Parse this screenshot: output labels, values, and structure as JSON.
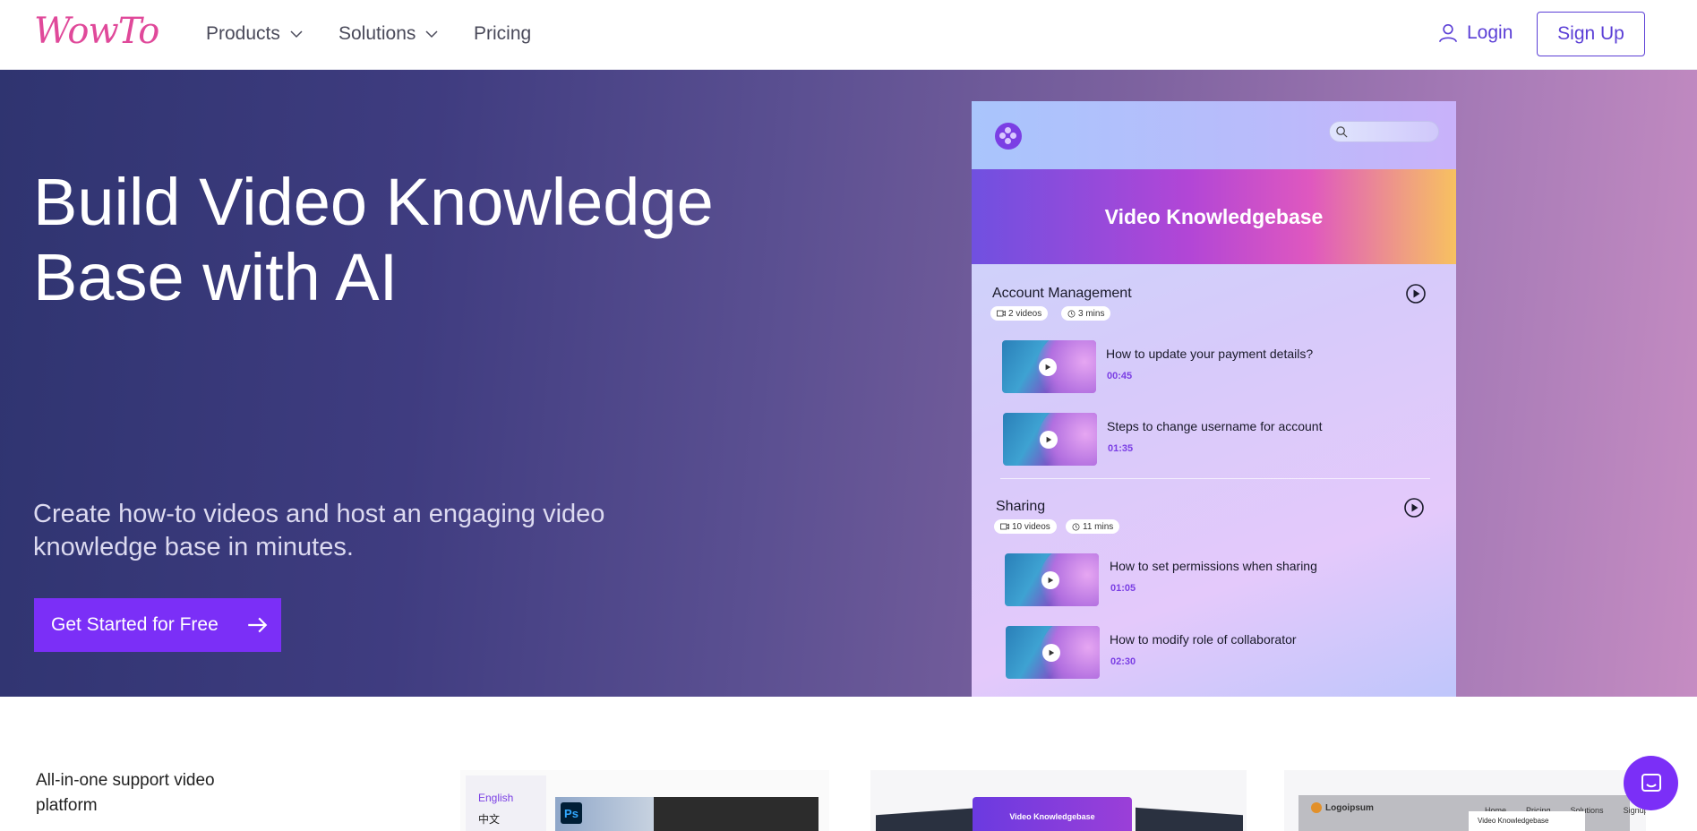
{
  "nav": {
    "logo": "WowTo",
    "products": "Products",
    "solutions": "Solutions",
    "pricing": "Pricing",
    "login": "Login",
    "signup": "Sign Up"
  },
  "hero": {
    "title": "Build Video Knowledge Base with AI",
    "subtitle": "Create how-to videos and host an engaging video knowledge base in minutes.",
    "cta": "Get Started for Free"
  },
  "mockup": {
    "banner": "Video Knowledgebase",
    "sections": [
      {
        "title": "Account Management",
        "videos_count": "2 videos",
        "duration": "3 mins",
        "items": [
          {
            "title": "How to update your payment details?",
            "time": "00:45"
          },
          {
            "title": "Steps to change username for account",
            "time": "01:35"
          }
        ]
      },
      {
        "title": "Sharing",
        "videos_count": "10 videos",
        "duration": "11 mins",
        "items": [
          {
            "title": "How to set permissions when sharing",
            "time": "01:05"
          },
          {
            "title": "How to modify role of collaborator",
            "time": "02:30"
          }
        ]
      }
    ]
  },
  "below": {
    "heading": "All-in-one support video platform",
    "card1": {
      "lang1": "English",
      "lang2": "中文",
      "ps": "Ps"
    },
    "card2": {
      "banner": "Video Knowledgebase"
    },
    "card3": {
      "logo": "Logoipsum",
      "menu": [
        "Home",
        "Pricing",
        "Solutions",
        "Signup"
      ],
      "mini": "Video Knowledgebase"
    }
  },
  "colors": {
    "accent": "#7b2ff7",
    "brand_pink": "#e0499a",
    "link": "#5b3fd6"
  },
  "icons": [
    "chevron-down-icon",
    "user-icon",
    "arrow-right-icon",
    "play-icon",
    "search-icon",
    "chat-icon",
    "video-icon",
    "clock-icon"
  ]
}
